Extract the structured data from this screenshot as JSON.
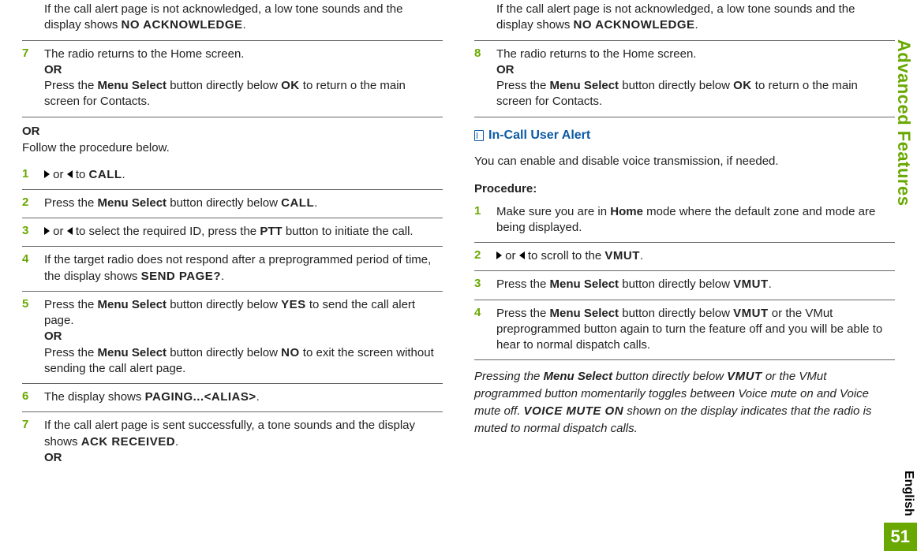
{
  "sidebar": {
    "label": "Advanced Features",
    "language": "English",
    "page": "51"
  },
  "left": {
    "cont": {
      "line1": "If the call alert page is not acknowledged, a low tone sounds and the display shows ",
      "code1": "NO ACKNOWLEDGE",
      "period": "."
    },
    "step7": {
      "num": "7",
      "l1": "The radio returns to the Home screen.",
      "or": "OR",
      "l2a": "Press the ",
      "bold1": "Menu Select",
      "l2b": " button directly below ",
      "code": "OK",
      "l2c": " to return o the main screen for Contacts."
    },
    "orBlock": {
      "or": "OR",
      "text": "Follow the procedure below."
    },
    "b1": {
      "num": "1",
      "pre": "",
      "mid": " or ",
      "post": " to ",
      "code": "CALL",
      "period": "."
    },
    "b2": {
      "num": "2",
      "a": "Press the ",
      "bold": "Menu Select",
      "b": " button directly below ",
      "code": "CALL",
      "period": "."
    },
    "b3": {
      "num": "3",
      "mid": " or ",
      "a": " to select the required ID, press the ",
      "bold": "PTT",
      "b": " button to initiate the call."
    },
    "b4": {
      "num": "4",
      "a": "If the target radio does not respond after a preprogrammed period of time, the display shows ",
      "code": "SEND PAGE?",
      "period": "."
    },
    "b5": {
      "num": "5",
      "a": "Press the ",
      "bold1": "Menu Select",
      "b": " button directly below ",
      "code1": "YES",
      "c": " to send the call alert page.",
      "or": "OR",
      "d": "Press the ",
      "bold2": "Menu Select",
      "e": " button directly below ",
      "code2": "NO",
      "f": " to exit the screen without sending the call alert page."
    },
    "b6": {
      "num": "6",
      "a": "The display shows ",
      "code": "PAGING...<ALIAS>",
      "period": "."
    },
    "b7": {
      "num": "7",
      "a": "If the call alert page is sent successfully, a tone sounds and the display shows ",
      "code": "ACK RECEIVED",
      "period": ".",
      "or": "OR"
    }
  },
  "right": {
    "cont": {
      "line1": "If the call alert page is not acknowledged, a low tone sounds and the display shows ",
      "code1": "NO ACKNOWLEDGE",
      "period": "."
    },
    "step8": {
      "num": "8",
      "l1": "The radio returns to the Home screen.",
      "or": "OR",
      "l2a": "Press the ",
      "bold1": "Menu Select",
      "l2b": " button directly below ",
      "code": "OK",
      "l2c": " to return o the main screen for Contacts."
    },
    "heading": "In-Call User Alert",
    "intro": "You can enable and disable voice transmission, if needed.",
    "procLabel": "Procedure:",
    "p1": {
      "num": "1",
      "a": "Make sure you are in ",
      "bold": "Home",
      "b": " mode where the default zone and mode are being displayed."
    },
    "p2": {
      "num": "2",
      "mid": " or ",
      "a": " to scroll to the ",
      "code": "VMUT",
      "period": "."
    },
    "p3": {
      "num": "3",
      "a": "Press the ",
      "bold": "Menu Select",
      "b": " button directly below ",
      "code": "VMUT",
      "period": "."
    },
    "p4": {
      "num": "4",
      "a": "Press the ",
      "bold": "Menu Select",
      "b": " button directly below ",
      "code": "VMUT",
      "c": " or the VMut preprogrammed button again to turn the feature off and you will be able to hear to normal dispatch calls."
    },
    "result": {
      "a": "Pressing the ",
      "bold": "Menu Select",
      "b": " button directly below ",
      "code1": "VMUT",
      "c": " or the VMut programmed button momentarily toggles between Voice mute on and Voice mute off. ",
      "code2": "VOICE MUTE ON",
      "d": " shown on the display indicates that the radio is muted to normal dispatch calls."
    }
  }
}
